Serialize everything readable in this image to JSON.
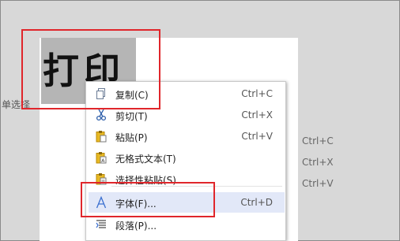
{
  "background": {
    "side_text": "单选择",
    "shortcuts": [
      "Ctrl+C",
      "Ctrl+X",
      "Ctrl+V"
    ]
  },
  "document": {
    "selected_text": "打印"
  },
  "context_menu": {
    "items": [
      {
        "label": "复制(C)",
        "shortcut": "Ctrl+C",
        "icon": "copy-icon"
      },
      {
        "label": "剪切(T)",
        "shortcut": "Ctrl+X",
        "icon": "scissors-icon"
      },
      {
        "label": "粘贴(P)",
        "shortcut": "Ctrl+V",
        "icon": "paste-icon"
      },
      {
        "label": "无格式文本(T)",
        "shortcut": "",
        "icon": "paste-plain-text-icon"
      },
      {
        "label": "选择性粘贴(S)...",
        "shortcut": "",
        "icon": "paste-special-icon"
      },
      {
        "label": "字体(F)...",
        "shortcut": "Ctrl+D",
        "icon": "font-icon",
        "highlighted": true
      },
      {
        "label": "段落(P)...",
        "shortcut": "",
        "icon": "paragraph-icon"
      }
    ]
  },
  "colors": {
    "highlight_box": "#e0262b",
    "menu_hover": "#e2e8f8",
    "selection": "#b5b5b5",
    "paste_icon": "#e8b923"
  }
}
